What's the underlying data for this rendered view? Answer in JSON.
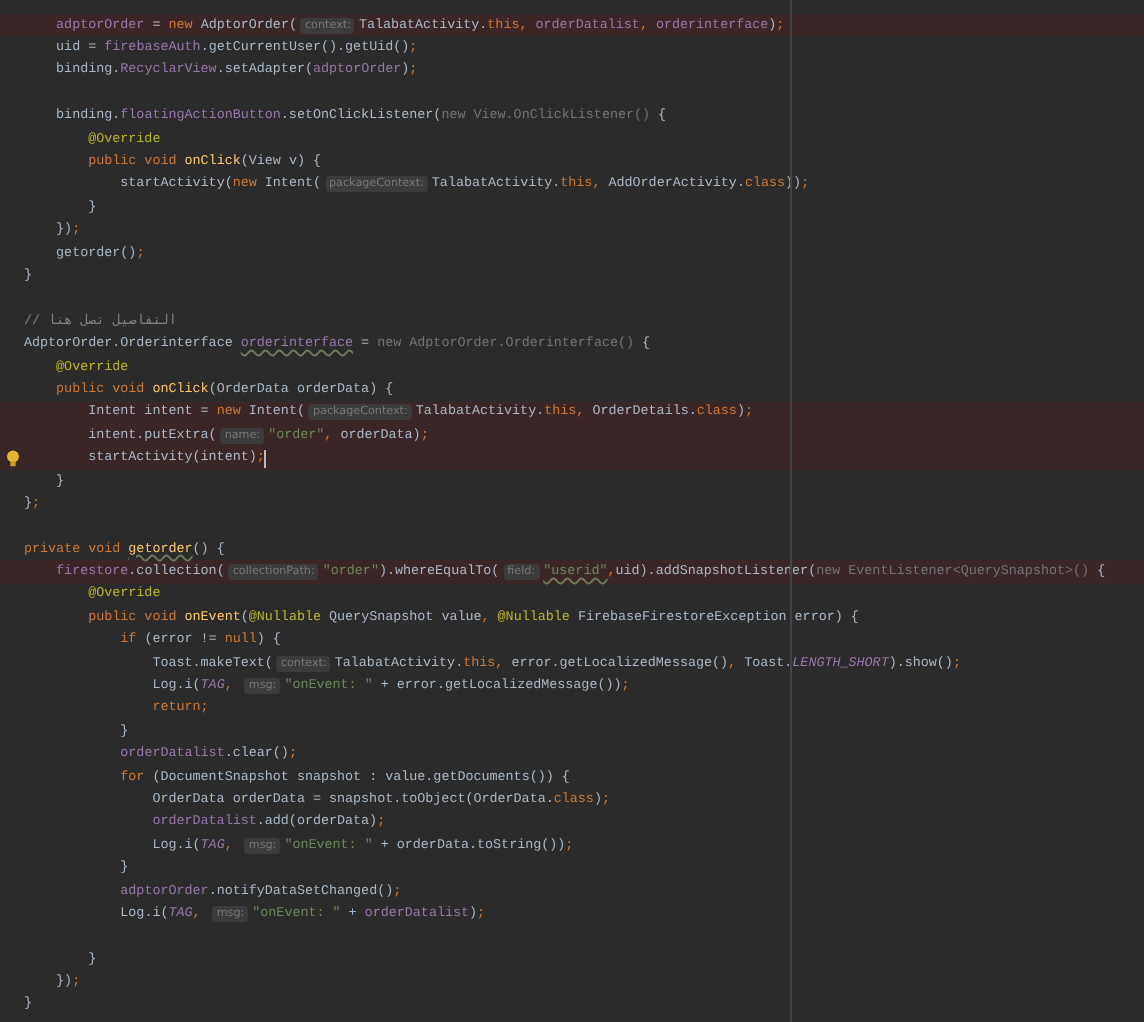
{
  "editor": {
    "lines": [
      {
        "highlighted": true,
        "bulb": false,
        "cursor": false,
        "tokens": [
          {
            "kind": "f",
            "text": "    adptorOrder"
          },
          {
            "kind": "p",
            "text": " = "
          },
          {
            "kind": "k",
            "text": "new "
          },
          {
            "kind": "p",
            "text": "AdptorOrder("
          },
          {
            "kind": "h",
            "text": "context:"
          },
          {
            "kind": "p",
            "text": "TalabatActivity."
          },
          {
            "kind": "k",
            "text": "this, "
          },
          {
            "kind": "f",
            "text": "orderDatalist"
          },
          {
            "kind": "k",
            "text": ", "
          },
          {
            "kind": "f",
            "text": "orderinterface"
          },
          {
            "kind": "p",
            "text": ")"
          },
          {
            "kind": "k",
            "text": ";"
          }
        ]
      },
      {
        "highlighted": false,
        "bulb": false,
        "cursor": false,
        "tokens": [
          {
            "kind": "p",
            "text": "    uid = "
          },
          {
            "kind": "f",
            "text": "firebaseAuth"
          },
          {
            "kind": "p",
            "text": ".getCurrentUser().getUid()"
          },
          {
            "kind": "k",
            "text": ";"
          }
        ]
      },
      {
        "highlighted": false,
        "bulb": false,
        "cursor": false,
        "tokens": [
          {
            "kind": "p",
            "text": "    binding."
          },
          {
            "kind": "f",
            "text": "RecyclarView"
          },
          {
            "kind": "p",
            "text": ".setAdapter("
          },
          {
            "kind": "f",
            "text": "adptorOrder"
          },
          {
            "kind": "p",
            "text": ")"
          },
          {
            "kind": "k",
            "text": ";"
          }
        ]
      },
      {
        "highlighted": false,
        "bulb": false,
        "cursor": false
      },
      {
        "highlighted": false,
        "bulb": false,
        "cursor": false,
        "tokens": [
          {
            "kind": "p",
            "text": "    binding."
          },
          {
            "kind": "f",
            "text": "floatingActionButton"
          },
          {
            "kind": "p",
            "text": ".setOnClickListener("
          },
          {
            "kind": "g",
            "text": "new View.OnClickListener() "
          },
          {
            "kind": "p",
            "text": "{"
          }
        ]
      },
      {
        "highlighted": false,
        "bulb": false,
        "cursor": false,
        "tokens": [
          {
            "kind": "a",
            "text": "        @Override"
          }
        ]
      },
      {
        "highlighted": false,
        "bulb": false,
        "cursor": false,
        "tokens": [
          {
            "kind": "k",
            "text": "        public void "
          },
          {
            "kind": "m",
            "text": "onClick"
          },
          {
            "kind": "p",
            "text": "(View v) {"
          }
        ]
      },
      {
        "highlighted": false,
        "bulb": false,
        "cursor": false,
        "tokens": [
          {
            "kind": "p",
            "text": "            startActivity("
          },
          {
            "kind": "k",
            "text": "new "
          },
          {
            "kind": "p",
            "text": "Intent("
          },
          {
            "kind": "h",
            "text": "packageContext:"
          },
          {
            "kind": "p",
            "text": "TalabatActivity."
          },
          {
            "kind": "k",
            "text": "this, "
          },
          {
            "kind": "p",
            "text": "AddOrderActivity."
          },
          {
            "kind": "k",
            "text": "class"
          },
          {
            "kind": "p",
            "text": "))"
          },
          {
            "kind": "k",
            "text": ";"
          }
        ]
      },
      {
        "highlighted": false,
        "bulb": false,
        "cursor": false,
        "tokens": [
          {
            "kind": "p",
            "text": "        }"
          }
        ]
      },
      {
        "highlighted": false,
        "bulb": false,
        "cursor": false,
        "tokens": [
          {
            "kind": "p",
            "text": "    })"
          },
          {
            "kind": "k",
            "text": ";"
          }
        ]
      },
      {
        "highlighted": false,
        "bulb": false,
        "cursor": false,
        "tokens": [
          {
            "kind": "p",
            "text": "    getorder()"
          },
          {
            "kind": "k",
            "text": ";"
          }
        ]
      },
      {
        "highlighted": false,
        "bulb": false,
        "cursor": false,
        "tokens": [
          {
            "kind": "p",
            "text": "}"
          }
        ]
      },
      {
        "highlighted": false,
        "bulb": false,
        "cursor": false
      },
      {
        "highlighted": false,
        "bulb": false,
        "cursor": false,
        "tokens": [
          {
            "kind": "c",
            "text": "// التفاصيل تصل هنا"
          }
        ]
      },
      {
        "highlighted": false,
        "bulb": false,
        "cursor": false,
        "tokens": [
          {
            "kind": "p",
            "text": "AdptorOrder.Orderinterface "
          },
          {
            "kind": "fu",
            "text": "orderinterface"
          },
          {
            "kind": "p",
            "text": " = "
          },
          {
            "kind": "g",
            "text": "new AdptorOrder.Orderinterface() "
          },
          {
            "kind": "p",
            "text": "{"
          }
        ]
      },
      {
        "highlighted": false,
        "bulb": false,
        "cursor": false,
        "tokens": [
          {
            "kind": "a",
            "text": "    @Override"
          }
        ]
      },
      {
        "highlighted": false,
        "bulb": false,
        "cursor": false,
        "tokens": [
          {
            "kind": "k",
            "text": "    public void "
          },
          {
            "kind": "m",
            "text": "onClick"
          },
          {
            "kind": "p",
            "text": "(OrderData orderData) {"
          }
        ]
      },
      {
        "highlighted": true,
        "bulb": false,
        "cursor": false,
        "tokens": [
          {
            "kind": "p",
            "text": "        Intent intent = "
          },
          {
            "kind": "k",
            "text": "new "
          },
          {
            "kind": "p",
            "text": "Intent("
          },
          {
            "kind": "h",
            "text": "packageContext:"
          },
          {
            "kind": "p",
            "text": "TalabatActivity."
          },
          {
            "kind": "k",
            "text": "this, "
          },
          {
            "kind": "p",
            "text": "OrderDetails."
          },
          {
            "kind": "k",
            "text": "class"
          },
          {
            "kind": "p",
            "text": ")"
          },
          {
            "kind": "k",
            "text": ";"
          }
        ]
      },
      {
        "highlighted": true,
        "bulb": false,
        "cursor": false,
        "tokens": [
          {
            "kind": "p",
            "text": "        intent.putExtra("
          },
          {
            "kind": "h",
            "text": "name:"
          },
          {
            "kind": "s",
            "text": "\"order\""
          },
          {
            "kind": "k",
            "text": ", "
          },
          {
            "kind": "p",
            "text": "orderData)"
          },
          {
            "kind": "k",
            "text": ";"
          }
        ]
      },
      {
        "highlighted": true,
        "bulb": true,
        "cursor": true,
        "tokens": [
          {
            "kind": "p",
            "text": "        startActivity(intent)"
          },
          {
            "kind": "k",
            "text": ";"
          }
        ]
      },
      {
        "highlighted": false,
        "bulb": false,
        "cursor": false,
        "tokens": [
          {
            "kind": "p",
            "text": "    }"
          }
        ]
      },
      {
        "highlighted": false,
        "bulb": false,
        "cursor": false,
        "tokens": [
          {
            "kind": "p",
            "text": "}"
          },
          {
            "kind": "k",
            "text": ";"
          }
        ]
      },
      {
        "highlighted": false,
        "bulb": false,
        "cursor": false
      },
      {
        "highlighted": false,
        "bulb": false,
        "cursor": false,
        "tokens": [
          {
            "kind": "k",
            "text": "private void "
          },
          {
            "kind": "mu",
            "text": "getorder"
          },
          {
            "kind": "p",
            "text": "() {"
          }
        ]
      },
      {
        "highlighted": true,
        "bulb": false,
        "cursor": false,
        "tokens": [
          {
            "kind": "f",
            "text": "    firestore"
          },
          {
            "kind": "p",
            "text": ".collection("
          },
          {
            "kind": "h",
            "text": "collectionPath:"
          },
          {
            "kind": "s",
            "text": "\"order\""
          },
          {
            "kind": "p",
            "text": ").whereEqualTo("
          },
          {
            "kind": "h",
            "text": "field:"
          },
          {
            "kind": "su",
            "text": "\"userid\""
          },
          {
            "kind": "k",
            "text": ","
          },
          {
            "kind": "p",
            "text": "uid).addSnapshotListener("
          },
          {
            "kind": "g",
            "text": "new EventListener<QuerySnapshot>() "
          },
          {
            "kind": "p",
            "text": "{"
          }
        ]
      },
      {
        "highlighted": false,
        "bulb": false,
        "cursor": false,
        "tokens": [
          {
            "kind": "a",
            "text": "        @Override"
          }
        ]
      },
      {
        "highlighted": false,
        "bulb": false,
        "cursor": false,
        "tokens": [
          {
            "kind": "k",
            "text": "        public void "
          },
          {
            "kind": "m",
            "text": "onEvent"
          },
          {
            "kind": "p",
            "text": "("
          },
          {
            "kind": "a",
            "text": "@Nullable "
          },
          {
            "kind": "p",
            "text": "QuerySnapshot value"
          },
          {
            "kind": "k",
            "text": ", "
          },
          {
            "kind": "a",
            "text": "@Nullable "
          },
          {
            "kind": "p",
            "text": "FirebaseFirestoreException error) {"
          }
        ]
      },
      {
        "highlighted": false,
        "bulb": false,
        "cursor": false,
        "tokens": [
          {
            "kind": "k",
            "text": "            if "
          },
          {
            "kind": "p",
            "text": "(error != "
          },
          {
            "kind": "k",
            "text": "null"
          },
          {
            "kind": "p",
            "text": ") {"
          }
        ]
      },
      {
        "highlighted": false,
        "bulb": false,
        "cursor": false,
        "tokens": [
          {
            "kind": "p",
            "text": "                Toast.makeText("
          },
          {
            "kind": "h",
            "text": "context:"
          },
          {
            "kind": "p",
            "text": "TalabatActivity."
          },
          {
            "kind": "k",
            "text": "this, "
          },
          {
            "kind": "p",
            "text": "error.getLocalizedMessage()"
          },
          {
            "kind": "k",
            "text": ", "
          },
          {
            "kind": "p",
            "text": "Toast."
          },
          {
            "kind": "i",
            "text": "LENGTH_SHORT"
          },
          {
            "kind": "p",
            "text": ").show()"
          },
          {
            "kind": "k",
            "text": ";"
          }
        ]
      },
      {
        "highlighted": false,
        "bulb": false,
        "cursor": false,
        "tokens": [
          {
            "kind": "p",
            "text": "                Log.i("
          },
          {
            "kind": "i",
            "text": "TAG"
          },
          {
            "kind": "k",
            "text": ", "
          },
          {
            "kind": "h",
            "text": "msg:"
          },
          {
            "kind": "s",
            "text": "\"onEvent: \""
          },
          {
            "kind": "p",
            "text": " + error.getLocalizedMessage())"
          },
          {
            "kind": "k",
            "text": ";"
          }
        ]
      },
      {
        "highlighted": false,
        "bulb": false,
        "cursor": false,
        "tokens": [
          {
            "kind": "k",
            "text": "                return;"
          }
        ]
      },
      {
        "highlighted": false,
        "bulb": false,
        "cursor": false,
        "tokens": [
          {
            "kind": "p",
            "text": "            }"
          }
        ]
      },
      {
        "highlighted": false,
        "bulb": false,
        "cursor": false,
        "tokens": [
          {
            "kind": "f",
            "text": "            orderDatalist"
          },
          {
            "kind": "p",
            "text": ".clear()"
          },
          {
            "kind": "k",
            "text": ";"
          }
        ]
      },
      {
        "highlighted": false,
        "bulb": false,
        "cursor": false,
        "tokens": [
          {
            "kind": "k",
            "text": "            for "
          },
          {
            "kind": "p",
            "text": "(DocumentSnapshot snapshot : value.getDocuments()) {"
          }
        ]
      },
      {
        "highlighted": false,
        "bulb": false,
        "cursor": false,
        "tokens": [
          {
            "kind": "p",
            "text": "                OrderData orderData = snapshot.toObject(OrderData."
          },
          {
            "kind": "k",
            "text": "class"
          },
          {
            "kind": "p",
            "text": ")"
          },
          {
            "kind": "k",
            "text": ";"
          }
        ]
      },
      {
        "highlighted": false,
        "bulb": false,
        "cursor": false,
        "tokens": [
          {
            "kind": "f",
            "text": "                orderDatalist"
          },
          {
            "kind": "p",
            "text": ".add(orderData)"
          },
          {
            "kind": "k",
            "text": ";"
          }
        ]
      },
      {
        "highlighted": false,
        "bulb": false,
        "cursor": false,
        "tokens": [
          {
            "kind": "p",
            "text": "                Log.i("
          },
          {
            "kind": "i",
            "text": "TAG"
          },
          {
            "kind": "k",
            "text": ", "
          },
          {
            "kind": "h",
            "text": "msg:"
          },
          {
            "kind": "s",
            "text": "\"onEvent: \""
          },
          {
            "kind": "p",
            "text": " + orderData.toString())"
          },
          {
            "kind": "k",
            "text": ";"
          }
        ]
      },
      {
        "highlighted": false,
        "bulb": false,
        "cursor": false,
        "tokens": [
          {
            "kind": "p",
            "text": "            }"
          }
        ]
      },
      {
        "highlighted": false,
        "bulb": false,
        "cursor": false,
        "tokens": [
          {
            "kind": "f",
            "text": "            adptorOrder"
          },
          {
            "kind": "p",
            "text": ".notifyDataSetChanged()"
          },
          {
            "kind": "k",
            "text": ";"
          }
        ]
      },
      {
        "highlighted": false,
        "bulb": false,
        "cursor": false,
        "tokens": [
          {
            "kind": "p",
            "text": "            Log.i("
          },
          {
            "kind": "i",
            "text": "TAG"
          },
          {
            "kind": "k",
            "text": ", "
          },
          {
            "kind": "h",
            "text": "msg:"
          },
          {
            "kind": "s",
            "text": "\"onEvent: \""
          },
          {
            "kind": "p",
            "text": " + "
          },
          {
            "kind": "f",
            "text": "orderDatalist"
          },
          {
            "kind": "p",
            "text": ")"
          },
          {
            "kind": "k",
            "text": ";"
          }
        ]
      },
      {
        "highlighted": false,
        "bulb": false,
        "cursor": false
      },
      {
        "highlighted": false,
        "bulb": false,
        "cursor": false,
        "tokens": [
          {
            "kind": "p",
            "text": "        }"
          }
        ]
      },
      {
        "highlighted": false,
        "bulb": false,
        "cursor": false,
        "tokens": [
          {
            "kind": "p",
            "text": "    })"
          },
          {
            "kind": "k",
            "text": ";"
          }
        ]
      },
      {
        "highlighted": false,
        "bulb": false,
        "cursor": false,
        "tokens": [
          {
            "kind": "p",
            "text": "}"
          }
        ]
      }
    ]
  }
}
